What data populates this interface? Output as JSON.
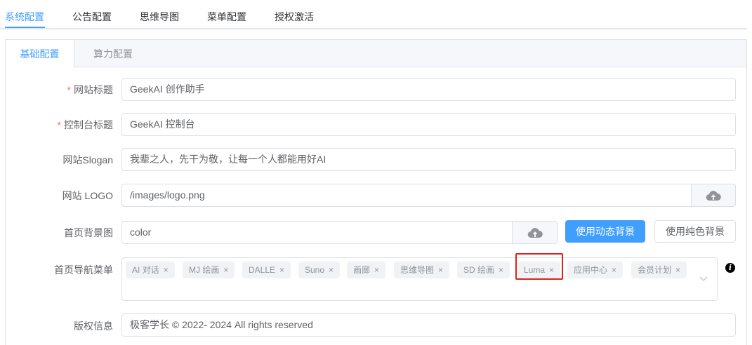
{
  "top_tabs": {
    "active": "系统配置",
    "items": [
      "系统配置",
      "公告配置",
      "思维导图",
      "菜单配置",
      "授权激活"
    ]
  },
  "inner_tabs": {
    "items": [
      "基础配置",
      "算力配置"
    ],
    "active": "基础配置"
  },
  "form": {
    "site_title": {
      "label": "网站标题",
      "required_mark": "*",
      "value": "GeekAI 创作助手"
    },
    "console_title": {
      "label": "控制台标题",
      "required_mark": "*",
      "value": "GeekAI 控制台"
    },
    "slogan": {
      "label": "网站Slogan",
      "value": "我辈之人，先干为敬，让每一个人都能用好AI"
    },
    "logo": {
      "label": "网站 LOGO",
      "value": "/images/logo.png",
      "upload_icon": "upload-cloud-icon"
    },
    "home_bg": {
      "label": "首页背景图",
      "value": "color",
      "upload_icon": "upload-cloud-icon",
      "dynamic_button": "使用动态背景",
      "solid_button": "使用纯色背景"
    },
    "nav_menu": {
      "label": "首页导航菜单",
      "tags": [
        "AI 对话",
        "MJ 绘画",
        "DALLE",
        "Suno",
        "画廊",
        "思维导图",
        "SD 绘画",
        "Luma",
        "应用中心",
        "会员计划"
      ],
      "close_glyph": "×",
      "info_glyph": "i"
    },
    "copyright": {
      "label": "版权信息",
      "value": "极客学长 © 2022- 2024 All rights reserved"
    }
  },
  "colors": {
    "accent": "#409eff",
    "required": "#f56c6c",
    "highlight_box": "#e02020"
  }
}
